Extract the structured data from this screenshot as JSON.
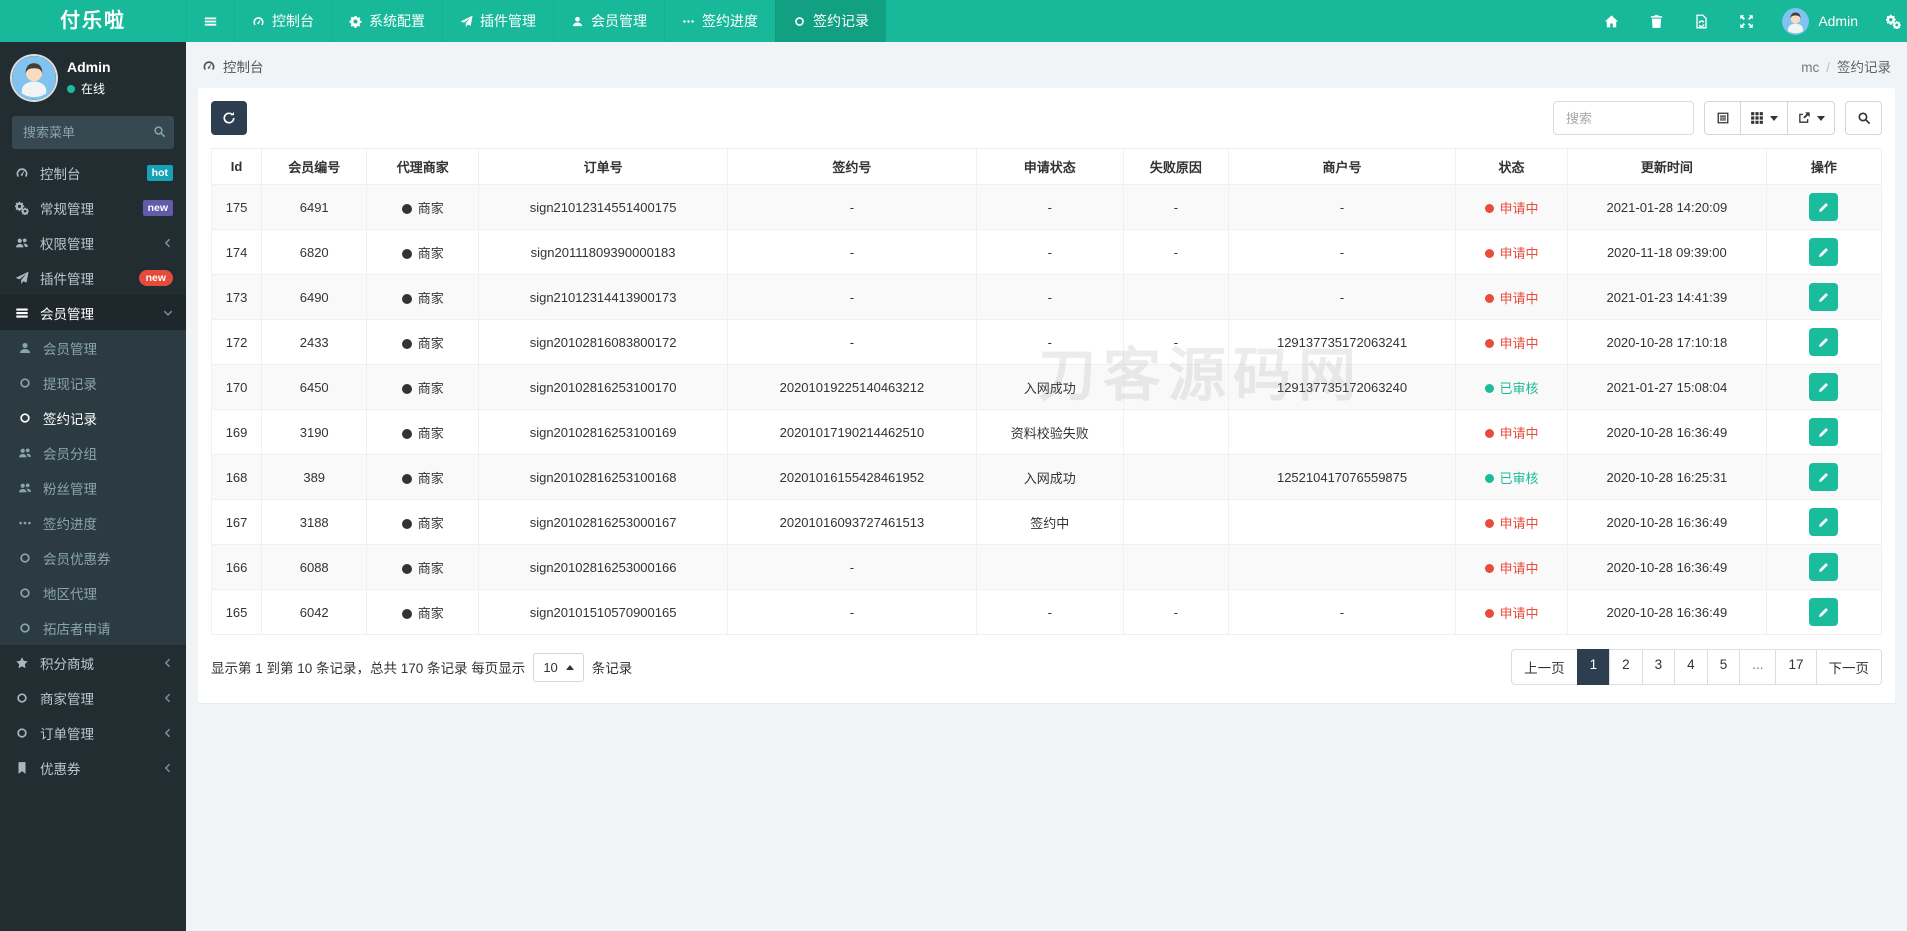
{
  "app": {
    "logo_text": "付乐啦"
  },
  "topnav": {
    "items": [
      {
        "name": "dashboard",
        "label": "控制台",
        "icon": "tachometer"
      },
      {
        "name": "system-config",
        "label": "系统配置",
        "icon": "gear"
      },
      {
        "name": "plugin-management",
        "label": "插件管理",
        "icon": "paper-plane"
      },
      {
        "name": "member-management",
        "label": "会员管理",
        "icon": "user"
      },
      {
        "name": "sign-progress",
        "label": "签约进度",
        "icon": "ellipsis"
      },
      {
        "name": "sign-records",
        "label": "签约记录",
        "icon": "circle",
        "active": true
      }
    ],
    "username": "Admin"
  },
  "sidebar": {
    "profile": {
      "name": "Admin",
      "status_label": "在线"
    },
    "search_placeholder": "搜索菜单",
    "items": [
      {
        "name": "dashboard",
        "label": "控制台",
        "icon": "tachometer",
        "badge": {
          "text": "hot",
          "style": "hot"
        }
      },
      {
        "name": "general-management",
        "label": "常规管理",
        "icon": "gears",
        "badge": {
          "text": "new",
          "style": "new-purple"
        }
      },
      {
        "name": "permission-management",
        "label": "权限管理",
        "icon": "users",
        "chevron": "left"
      },
      {
        "name": "plugin-management",
        "label": "插件管理",
        "icon": "paper-plane",
        "badge": {
          "text": "new",
          "style": "new-red"
        }
      },
      {
        "name": "member-management",
        "label": "会员管理",
        "icon": "th-list",
        "chevron": "down",
        "active": true,
        "children": [
          {
            "name": "member-management-sub",
            "label": "会员管理",
            "icon": "user"
          },
          {
            "name": "withdraw-records",
            "label": "提现记录",
            "icon": "circle"
          },
          {
            "name": "sign-records",
            "label": "签约记录",
            "icon": "circle",
            "active": true
          },
          {
            "name": "member-groups",
            "label": "会员分组",
            "icon": "users"
          },
          {
            "name": "fans-management",
            "label": "粉丝管理",
            "icon": "users"
          },
          {
            "name": "sign-progress",
            "label": "签约进度",
            "icon": "ellipsis"
          },
          {
            "name": "member-coupons",
            "label": "会员优惠券",
            "icon": "circle"
          },
          {
            "name": "region-agents",
            "label": "地区代理",
            "icon": "circle"
          },
          {
            "name": "shop-expander-apply",
            "label": "拓店者申请",
            "icon": "circle"
          }
        ]
      },
      {
        "name": "points-mall",
        "label": "积分商城",
        "icon": "star",
        "chevron": "left"
      },
      {
        "name": "merchant-management",
        "label": "商家管理",
        "icon": "circle",
        "chevron": "left"
      },
      {
        "name": "order-management",
        "label": "订单管理",
        "icon": "circle",
        "chevron": "left"
      },
      {
        "name": "coupons",
        "label": "优惠券",
        "icon": "bookmark",
        "chevron": "left"
      }
    ]
  },
  "breadcrumb": {
    "left_label": "控制台",
    "right_parent": "mc",
    "separator": "/",
    "right_current": "签约记录"
  },
  "toolbar": {
    "search_placeholder": "搜索"
  },
  "table": {
    "headers": [
      "Id",
      "会员编号",
      "代理商家",
      "订单号",
      "签约号",
      "申请状态",
      "失败原因",
      "商户号",
      "状态",
      "更新时间",
      "操作"
    ],
    "rows": [
      {
        "id": "175",
        "member_no": "6491",
        "agent": "商家",
        "order_no": "sign21012314551400175",
        "sign_no": "-",
        "apply_status": "-",
        "fail_reason": "-",
        "merchant_no": "-",
        "status": "申请中",
        "status_type": "pending",
        "updated": "2021-01-28 14:20:09"
      },
      {
        "id": "174",
        "member_no": "6820",
        "agent": "商家",
        "order_no": "sign20111809390000183",
        "sign_no": "-",
        "apply_status": "-",
        "fail_reason": "-",
        "merchant_no": "-",
        "status": "申请中",
        "status_type": "pending",
        "updated": "2020-11-18 09:39:00"
      },
      {
        "id": "173",
        "member_no": "6490",
        "agent": "商家",
        "order_no": "sign21012314413900173",
        "sign_no": "-",
        "apply_status": "-",
        "fail_reason": "",
        "merchant_no": "-",
        "status": "申请中",
        "status_type": "pending",
        "updated": "2021-01-23 14:41:39"
      },
      {
        "id": "172",
        "member_no": "2433",
        "agent": "商家",
        "order_no": "sign20102816083800172",
        "sign_no": "-",
        "apply_status": "-",
        "fail_reason": "-",
        "merchant_no": "129137735172063241",
        "status": "申请中",
        "status_type": "pending",
        "updated": "2020-10-28 17:10:18"
      },
      {
        "id": "170",
        "member_no": "6450",
        "agent": "商家",
        "order_no": "sign20102816253100170",
        "sign_no": "20201019225140463212",
        "apply_status": "入网成功",
        "fail_reason": "",
        "merchant_no": "129137735172063240",
        "status": "已审核",
        "status_type": "approved",
        "updated": "2021-01-27 15:08:04"
      },
      {
        "id": "169",
        "member_no": "3190",
        "agent": "商家",
        "order_no": "sign20102816253100169",
        "sign_no": "20201017190214462510",
        "apply_status": "资料校验失败",
        "fail_reason": "",
        "merchant_no": "",
        "status": "申请中",
        "status_type": "pending",
        "updated": "2020-10-28 16:36:49"
      },
      {
        "id": "168",
        "member_no": "389",
        "agent": "商家",
        "order_no": "sign20102816253100168",
        "sign_no": "20201016155428461952",
        "apply_status": "入网成功",
        "fail_reason": "",
        "merchant_no": "125210417076559875",
        "status": "已审核",
        "status_type": "approved",
        "updated": "2020-10-28 16:25:31"
      },
      {
        "id": "167",
        "member_no": "3188",
        "agent": "商家",
        "order_no": "sign20102816253000167",
        "sign_no": "20201016093727461513",
        "apply_status": "签约中",
        "fail_reason": "",
        "merchant_no": "",
        "status": "申请中",
        "status_type": "pending",
        "updated": "2020-10-28 16:36:49"
      },
      {
        "id": "166",
        "member_no": "6088",
        "agent": "商家",
        "order_no": "sign20102816253000166",
        "sign_no": "-",
        "apply_status": "",
        "fail_reason": "",
        "merchant_no": "",
        "status": "申请中",
        "status_type": "pending",
        "updated": "2020-10-28 16:36:49"
      },
      {
        "id": "165",
        "member_no": "6042",
        "agent": "商家",
        "order_no": "sign20101510570900165",
        "sign_no": "-",
        "apply_status": "-",
        "fail_reason": "-",
        "merchant_no": "-",
        "status": "申请中",
        "status_type": "pending",
        "updated": "2020-10-28 16:36:49"
      }
    ]
  },
  "pagination": {
    "info_prefix": "显示第 1 到第 10 条记录，总共 170 条记录 每页显示",
    "page_size": "10",
    "info_suffix": "条记录",
    "prev_label": "上一页",
    "pages": [
      "1",
      "2",
      "3",
      "4",
      "5",
      "...",
      "17"
    ],
    "active_page": "1",
    "next_label": "下一页"
  },
  "watermark_text": "刀客源码网",
  "colors": {
    "navbar_teal": "#18b99b",
    "navbar_active": "#12a083",
    "sidebar_bg": "#222d32",
    "submenu_bg": "#2c3b41",
    "sidebar_active_bg": "#1e282c",
    "navy": "#2c3e50",
    "green": "#1abc9c",
    "red": "#e74c3c",
    "badge_hot": "#17a2b8",
    "badge_new_purple": "#605ca8",
    "badge_new_red": "#e64a3b"
  }
}
